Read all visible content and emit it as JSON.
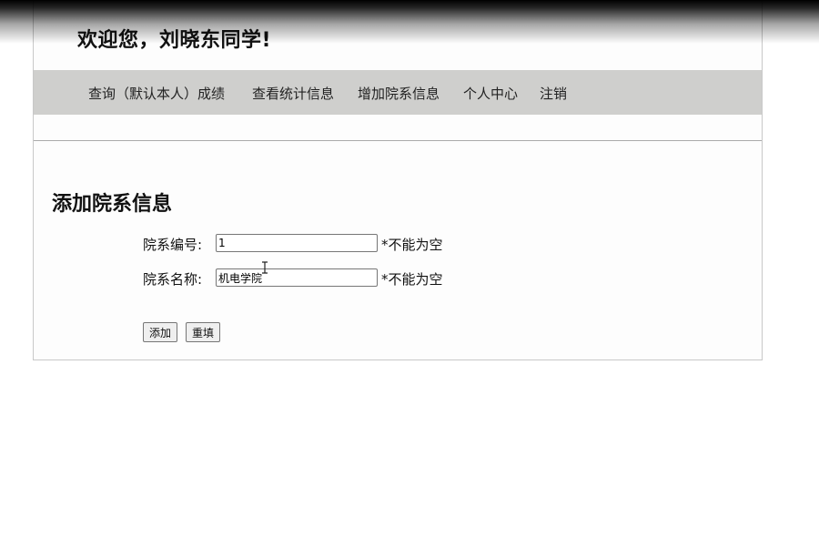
{
  "header": {
    "welcome": "欢迎您，刘晓东同学!"
  },
  "nav": {
    "items": [
      {
        "label": "查询（默认本人）成绩"
      },
      {
        "label": "查看统计信息"
      },
      {
        "label": "增加院系信息"
      },
      {
        "label": "个人中心"
      },
      {
        "label": "注销"
      }
    ]
  },
  "form": {
    "title": "添加院系信息",
    "fields": [
      {
        "label": "院系编号:",
        "value": "1",
        "hint": "*不能为空"
      },
      {
        "label": "院系名称:",
        "value": "机电学院",
        "hint": "*不能为空"
      }
    ],
    "submit_label": "添加",
    "reset_label": "重填"
  },
  "icons": {
    "text_cursor": "i-beam-cursor-icon"
  }
}
